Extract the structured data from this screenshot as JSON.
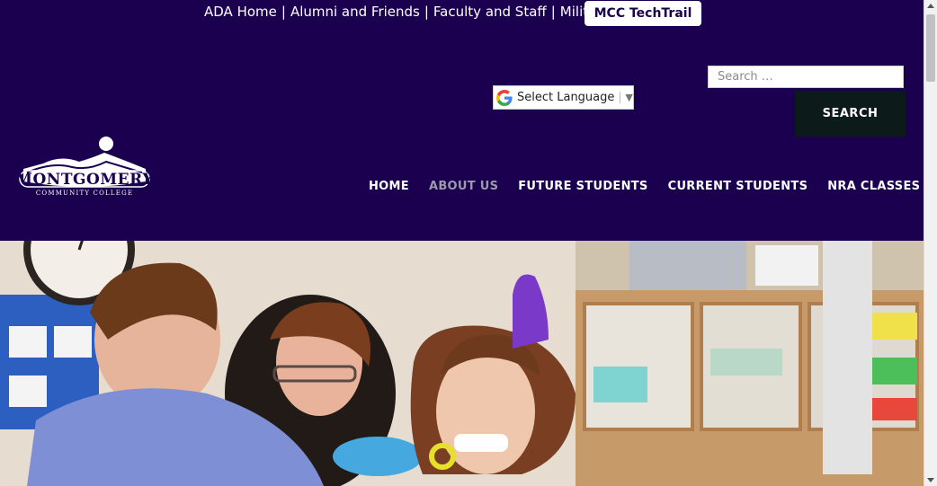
{
  "top_links": {
    "ada": "ADA Home",
    "alumni": "Alumni and Friends",
    "faculty": "Faculty and Staff",
    "military": "Military",
    "separator": "|",
    "techtrail": "MCC TechTrail"
  },
  "search": {
    "placeholder": "Search …",
    "button_label": "SEARCH"
  },
  "translate": {
    "label": "Select Language",
    "caret": "▼"
  },
  "logo": {
    "name": "MONTGOMERY",
    "tagline": "COMMUNITY COLLEGE"
  },
  "nav": {
    "items": [
      {
        "label": "HOME"
      },
      {
        "label": "ABOUT US"
      },
      {
        "label": "FUTURE STUDENTS"
      },
      {
        "label": "CURRENT STUDENTS"
      },
      {
        "label": "NRA CLASSES"
      }
    ]
  },
  "colors": {
    "header_bg": "#1b0050",
    "search_button_bg": "#0d1a1a",
    "nav_active": "#9a9aa8"
  }
}
